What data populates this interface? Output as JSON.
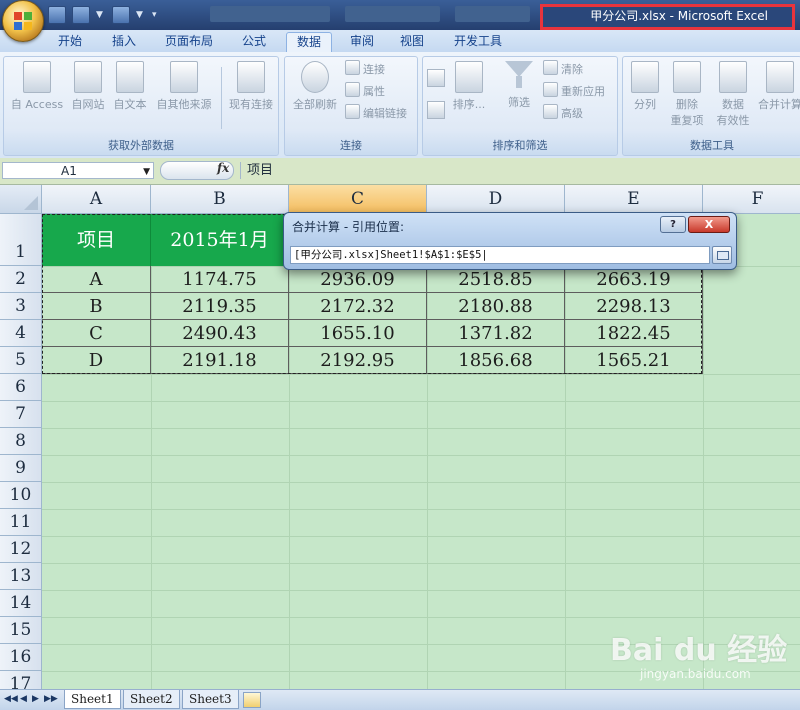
{
  "window": {
    "title": "甲分公司.xlsx - Microsoft Excel",
    "highlight_color": "#e8343d"
  },
  "tabs": [
    "开始",
    "插入",
    "页面布局",
    "公式",
    "数据",
    "审阅",
    "视图",
    "开发工具"
  ],
  "active_tab": "数据",
  "ribbon": {
    "groups": [
      {
        "label": "获取外部数据",
        "buttons": [
          "自 Access",
          "自网站",
          "自文本",
          "自其他来源",
          "现有连接"
        ]
      },
      {
        "label": "连接",
        "buttons": [
          "全部刷新",
          "连接",
          "属性",
          "编辑链接"
        ]
      },
      {
        "label": "排序和筛选",
        "buttons": [
          "排序...",
          "筛选",
          "清除",
          "重新应用",
          "高级"
        ]
      },
      {
        "label": "数据工具",
        "buttons": [
          "分列",
          "删除",
          "重复项",
          "数据",
          "有效性",
          "合并计算"
        ]
      }
    ],
    "icons": [
      "access-icon",
      "web-icon",
      "text-file-icon",
      "other-sources-icon",
      "existing-connections-icon",
      "refresh-icon",
      "filter-funnel-icon"
    ]
  },
  "formula_bar": {
    "name_box": "A1",
    "fx_label": "fx",
    "value": "项目"
  },
  "columns": [
    "A",
    "B",
    "C",
    "D",
    "E",
    "F"
  ],
  "selected_column": "C",
  "rows": [
    "1",
    "2",
    "3",
    "4",
    "5",
    "6",
    "7",
    "8",
    "9",
    "10",
    "11",
    "12",
    "13",
    "14",
    "15",
    "16",
    "17"
  ],
  "table": {
    "header": [
      "项目",
      "2015年1月",
      "",
      "",
      ""
    ],
    "header_color": "#17a84c",
    "data": [
      [
        "A",
        "1174.75",
        "2936.09",
        "2518.85",
        "2663.19"
      ],
      [
        "B",
        "2119.35",
        "2172.32",
        "2180.88",
        "2298.13"
      ],
      [
        "C",
        "2490.43",
        "1655.10",
        "1371.82",
        "1822.45"
      ],
      [
        "D",
        "2191.18",
        "2192.95",
        "1856.68",
        "1565.21"
      ]
    ]
  },
  "dialog": {
    "title": "合并计算 - 引用位置:",
    "help_label": "?",
    "close_label": "X",
    "reference": "[甲分公司.xlsx]Sheet1!$A$1:$E$5|"
  },
  "sheets": [
    "Sheet1",
    "Sheet2",
    "Sheet3"
  ],
  "active_sheet": "Sheet1",
  "nav_buttons": [
    "◀◀",
    "◀",
    "▶",
    "▶▶"
  ],
  "watermark": {
    "brand": "Bai du 经验",
    "url": "jingyan.baidu.com"
  }
}
